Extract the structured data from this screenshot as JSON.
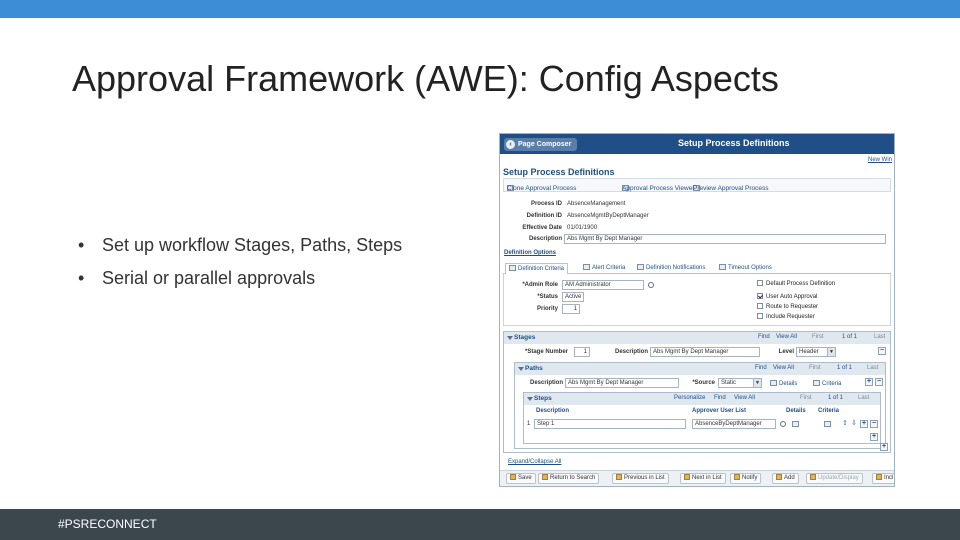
{
  "slide": {
    "title": "Approval Framework (AWE): Config Aspects",
    "bullets": [
      "Set up workflow Stages, Paths, Steps",
      "Serial or parallel approvals"
    ],
    "footer": "#PSRECONNECT",
    "colors": {
      "topbar": "#3c8dd4",
      "footer": "#3b474d"
    }
  },
  "screenshot": {
    "page_composer": "Page Composer",
    "header_title": "Setup Process Definitions",
    "new_window": "New Win",
    "page_heading": "Setup Process Definitions",
    "actions": [
      "Clone Approval Process",
      "Approval Process Viewer",
      "Preview Approval Process"
    ],
    "fields": {
      "process_id_label": "Process ID",
      "process_id_value": "AbsenceManagement",
      "definition_id_label": "Definition ID",
      "definition_id_value": "AbsenceMgmtByDeptManager",
      "effective_date_label": "Effective Date",
      "effective_date_value": "01/01/1900",
      "description_label": "Description",
      "description_value": "Abs Mgmt By Dept Manager"
    },
    "definition_options": {
      "label": "Definition Options",
      "tabs": [
        "Definition Criteria",
        "Alert Criteria",
        "Definition Notifications",
        "Timeout Options"
      ],
      "admin_role_label": "*Admin Role",
      "admin_role_value": "AM Administrator",
      "status_label": "*Status",
      "status_value": "Active",
      "priority_label": "Priority",
      "priority_value": "1",
      "checkboxes": [
        {
          "label": "Default Process Definition",
          "checked": false
        },
        {
          "label": "User Auto Approval",
          "checked": true
        },
        {
          "label": "Route to Requester",
          "checked": false
        },
        {
          "label": "Include Requester",
          "checked": false
        }
      ]
    },
    "stages": {
      "title": "Stages",
      "nav": {
        "find": "Find",
        "view_all": "View All",
        "first": "First",
        "count": "1 of 1",
        "last": "Last"
      },
      "stage_number_label": "*Stage Number",
      "stage_number_value": "1",
      "description_label": "Description",
      "description_value": "Abs Mgmt By Dept Manager",
      "level_label": "Level",
      "level_value": "Header"
    },
    "paths": {
      "title": "Paths",
      "nav": {
        "find": "Find",
        "view_all": "View All",
        "first": "First",
        "count": "1 of 1",
        "last": "Last"
      },
      "description_label": "Description",
      "description_value": "Abs Mgmt By Dept Manager",
      "source_label": "*Source",
      "source_value": "Static",
      "details": "Details",
      "criteria": "Criteria"
    },
    "steps": {
      "title": "Steps",
      "nav": {
        "personalize": "Personalize",
        "find": "Find",
        "view_all": "View All",
        "first": "First",
        "count": "1 of 1",
        "last": "Last"
      },
      "columns": [
        "Description",
        "Approver User List",
        "Details",
        "Criteria"
      ],
      "rows": [
        {
          "num": "1",
          "description": "Step 1",
          "approver_list": "AbsenceByDeptManager"
        }
      ]
    },
    "expand_link": "Expand/Collapse All",
    "toolbar": [
      {
        "label": "Save",
        "enabled": true
      },
      {
        "label": "Return to Search",
        "enabled": true
      },
      {
        "label": "Previous in List",
        "enabled": true
      },
      {
        "label": "Next in List",
        "enabled": true
      },
      {
        "label": "Notify",
        "enabled": true
      },
      {
        "label": "Add",
        "enabled": true
      },
      {
        "label": "Update/Display",
        "enabled": false
      },
      {
        "label": "Incl",
        "enabled": true
      }
    ]
  }
}
